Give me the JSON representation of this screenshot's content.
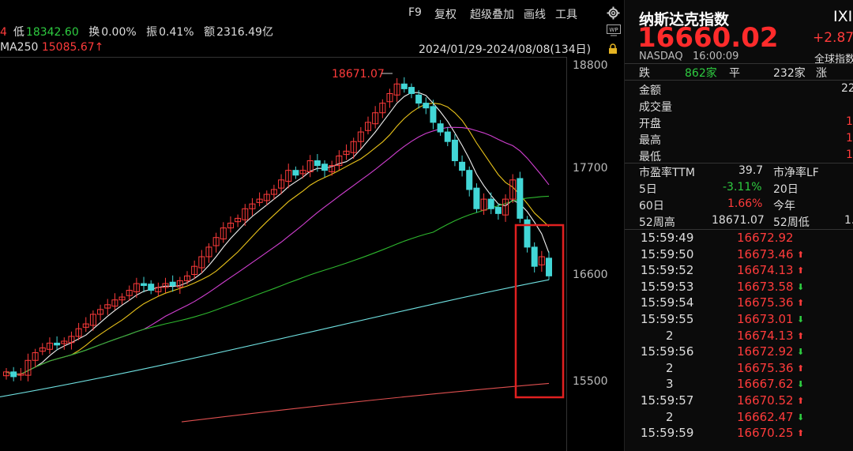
{
  "toolbar": {
    "f9": "F9",
    "restore_rights": "复权",
    "overlay": "超级叠加",
    "draw_line": "画线",
    "tools": "工具"
  },
  "stats": {
    "lead_fragment": "4",
    "low_label": "低",
    "low_value": "18342.60",
    "turnover_label": "换",
    "turnover_value": "0.00%",
    "amplitude_label": "振",
    "amplitude_value": "0.41%",
    "amount_label": "额",
    "amount_value": "2316.49亿"
  },
  "ma": {
    "label": "MA250",
    "value": "15085.67",
    "arrow": "↑"
  },
  "date_range": "2024/01/29-2024/08/08(134日)",
  "chart": {
    "peak_label": "18671.07",
    "y_ticks": [
      "18800",
      "17700",
      "16600",
      "15500"
    ]
  },
  "index": {
    "name": "纳斯达克指数",
    "code": "IXI",
    "price": "16660.02",
    "change": "+2.87",
    "exchange": "NASDAQ",
    "time": "16:00:09",
    "category": "全球指数"
  },
  "breadth": {
    "down_label": "跌",
    "down_value": "862家",
    "flat_label": "平",
    "flat_value": "232家",
    "up_label": "涨"
  },
  "fields": [
    {
      "label": "金额",
      "value": "22"
    },
    {
      "label": "成交量",
      "value": ""
    },
    {
      "label": "开盘",
      "value": "1"
    },
    {
      "label": "最高",
      "value": "1"
    },
    {
      "label": "最低",
      "value": "1"
    }
  ],
  "valuation": {
    "pe_label": "市盈率TTM",
    "pe_value": "39.7",
    "pb_label": "市净率LF",
    "d5_label": "5日",
    "d5_value": "-3.11%",
    "d20_label": "20日",
    "d60_label": "60日",
    "d60_value": "1.66%",
    "ytd_label": "今年",
    "high52_label": "52周高",
    "high52_value": "18671.07",
    "low52_label": "52周低",
    "low52_value": "1."
  },
  "ticks": [
    {
      "time": "15:59:49",
      "price": "16672.92",
      "dir": ""
    },
    {
      "time": "15:59:50",
      "price": "16673.46",
      "dir": "up"
    },
    {
      "time": "15:59:52",
      "price": "16674.13",
      "dir": "up"
    },
    {
      "time": "15:59:53",
      "price": "16673.58",
      "dir": "down"
    },
    {
      "time": "15:59:54",
      "price": "16675.36",
      "dir": "up"
    },
    {
      "time": "15:59:55",
      "price": "16673.01",
      "dir": "down"
    },
    {
      "time": "2",
      "price": "16674.13",
      "dir": "up"
    },
    {
      "time": "15:59:56",
      "price": "16672.92",
      "dir": "down"
    },
    {
      "time": "2",
      "price": "16675.36",
      "dir": "up"
    },
    {
      "time": "3",
      "price": "16667.62",
      "dir": "down"
    },
    {
      "time": "15:59:57",
      "price": "16670.52",
      "dir": "up"
    },
    {
      "time": "2",
      "price": "16662.47",
      "dir": "down"
    },
    {
      "time": "15:59:59",
      "price": "16670.25",
      "dir": "up"
    }
  ],
  "colors": {
    "up": "#ff3b3b",
    "down": "#2ecc40",
    "candle_down": "#42d6d6",
    "highlight_box": "#e02020"
  },
  "icons": {
    "settings": "gear-icon",
    "wp": "wp-icon",
    "lock": "lock-icon",
    "collapse": "chevron-right-icon"
  }
}
